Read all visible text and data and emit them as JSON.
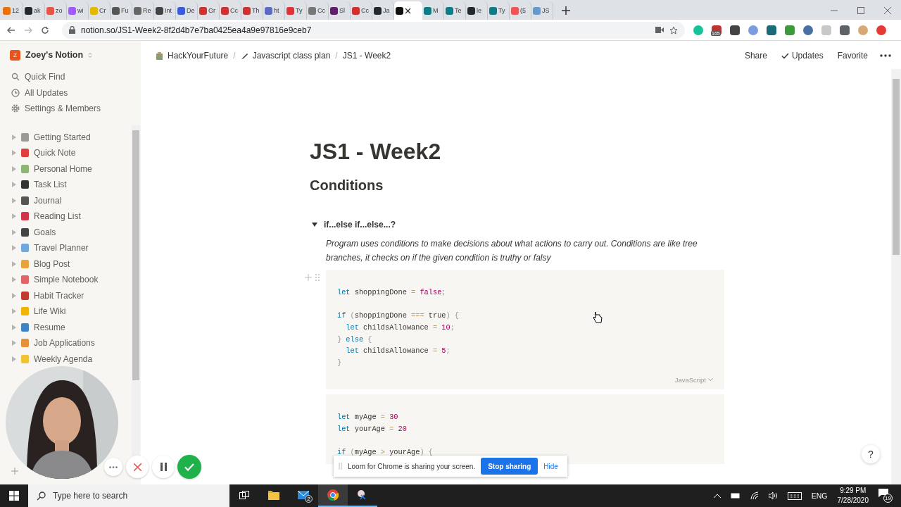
{
  "browser": {
    "tabs": [
      {
        "title": "12",
        "color": "#e8710a",
        "selected": false
      },
      {
        "title": "ak",
        "color": "#24292e",
        "selected": false
      },
      {
        "title": "zo",
        "color": "#e45649",
        "selected": false
      },
      {
        "title": "wi",
        "color": "#a259ff",
        "selected": false
      },
      {
        "title": "Cr",
        "color": "#e5b800",
        "selected": false
      },
      {
        "title": "Fu",
        "color": "#555555",
        "selected": false
      },
      {
        "title": "Re",
        "color": "#666666",
        "selected": false
      },
      {
        "title": "Int",
        "color": "#444444",
        "selected": false
      },
      {
        "title": "De",
        "color": "#3b5bdb",
        "selected": false
      },
      {
        "title": "Gr",
        "color": "#d03030",
        "selected": false
      },
      {
        "title": "Cc",
        "color": "#d03030",
        "selected": false
      },
      {
        "title": "Th",
        "color": "#d03030",
        "selected": false
      },
      {
        "title": "ht",
        "color": "#5c6bc0",
        "selected": false
      },
      {
        "title": "Ty",
        "color": "#e03333",
        "selected": false
      },
      {
        "title": "Cc",
        "color": "#777777",
        "selected": false
      },
      {
        "title": "Sl",
        "color": "#611f69",
        "selected": false
      },
      {
        "title": "Cc",
        "color": "#d03030",
        "selected": false
      },
      {
        "title": "Ja",
        "color": "#24292e",
        "selected": false
      },
      {
        "color": "#111111",
        "selected": true
      },
      {
        "title": "M",
        "color": "#0e7c86",
        "selected": false
      },
      {
        "title": "Te",
        "color": "#0e7c86",
        "selected": false
      },
      {
        "title": "le",
        "color": "#24292e",
        "selected": false
      },
      {
        "title": "Ty",
        "color": "#0e7c86",
        "selected": false
      },
      {
        "title": "(5",
        "color": "#f05555",
        "selected": false
      },
      {
        "title": "JS",
        "color": "#6699cc",
        "selected": false
      }
    ],
    "url": "notion.so/JS1-Week2-8f2d4b7e7ba0425ea4a9e97816e9ceb7",
    "extension_badge": "165"
  },
  "sidebar": {
    "workspace": "Zoey's Notion",
    "workspace_initial": "Z",
    "nav": [
      {
        "label": "Quick Find",
        "kind": "search"
      },
      {
        "label": "All Updates",
        "kind": "clock"
      },
      {
        "label": "Settings & Members",
        "kind": "gear"
      }
    ],
    "pages": [
      {
        "label": "Getting Started",
        "color": "#9b9a97",
        "expanded": false
      },
      {
        "label": "Quick Note",
        "color": "#e03e3e",
        "expanded": false
      },
      {
        "label": "Personal Home",
        "color": "#8fb573",
        "expanded": false
      },
      {
        "label": "Task List",
        "color": "#333333",
        "expanded": false
      },
      {
        "label": "Journal",
        "color": "#555555",
        "expanded": false
      },
      {
        "label": "Reading List",
        "color": "#d1334a",
        "expanded": false
      },
      {
        "label": "Goals",
        "color": "#444444",
        "expanded": false
      },
      {
        "label": "Travel Planner",
        "color": "#6fa8dc",
        "expanded": false
      },
      {
        "label": "Blog Post",
        "color": "#e8a33d",
        "expanded": false
      },
      {
        "label": "Simple Notebook",
        "color": "#e06666",
        "expanded": false
      },
      {
        "label": "Habit Tracker",
        "color": "#c0392b",
        "expanded": false
      },
      {
        "label": "Life Wiki",
        "color": "#f0b400",
        "expanded": false
      },
      {
        "label": "Resume",
        "color": "#3d85c6",
        "expanded": false
      },
      {
        "label": "Job Applications",
        "color": "#e69138",
        "expanded": false
      },
      {
        "label": "Weekly Agenda",
        "color": "#f1c232",
        "expanded": false
      }
    ]
  },
  "topbar": {
    "breadcrumbs": [
      {
        "label": "HackYourFuture"
      },
      {
        "label": "Javascript class plan",
        "separator": "/"
      },
      {
        "label": "JS1 - Week2",
        "separator": "/"
      }
    ],
    "actions": [
      {
        "label": "Share",
        "kind": "text"
      },
      {
        "label": "Updates",
        "kind": "check"
      },
      {
        "label": "Favorite",
        "kind": "text"
      }
    ]
  },
  "page": {
    "title": "JS1 - Week2",
    "heading": "Conditions",
    "toggle": {
      "label": "if...else if...else...?",
      "expanded": true,
      "text": "Program uses conditions to make decisions about what actions to carry out. Conditions are like tree branches, it checks on if the given condition is truthy or falsy"
    },
    "code_blocks": [
      {
        "language": "JavaScript",
        "lines": [
          {
            "kind": "code",
            "tokens": [
              {
                "kind": "kw",
                "t": "let"
              },
              {
                "kind": "plain",
                "t": " shoppingDone "
              },
              {
                "kind": "op",
                "t": "="
              },
              {
                "kind": "val",
                "t": " false"
              },
              {
                "kind": "punc",
                "t": ";"
              }
            ]
          },
          {
            "kind": "blank"
          },
          {
            "kind": "code",
            "tokens": [
              {
                "kind": "kw",
                "t": "if"
              },
              {
                "kind": "punc",
                "t": " ("
              },
              {
                "kind": "plain",
                "t": "shoppingDone "
              },
              {
                "kind": "op",
                "t": "==="
              },
              {
                "kind": "plain",
                "t": " true"
              },
              {
                "kind": "punc",
                "t": ") {"
              }
            ]
          },
          {
            "kind": "code",
            "tokens": [
              {
                "kind": "kw",
                "t": "  let"
              },
              {
                "kind": "plain",
                "t": " childsAllowance "
              },
              {
                "kind": "op",
                "t": "="
              },
              {
                "kind": "val",
                "t": " 10"
              },
              {
                "kind": "punc",
                "t": ";"
              }
            ]
          },
          {
            "kind": "code",
            "tokens": [
              {
                "kind": "punc",
                "t": "}"
              },
              {
                "kind": "kw",
                "t": " else"
              },
              {
                "kind": "punc",
                "t": " {"
              }
            ]
          },
          {
            "kind": "code",
            "tokens": [
              {
                "kind": "kw",
                "t": "  let"
              },
              {
                "kind": "plain",
                "t": " childsAllowance "
              },
              {
                "kind": "op",
                "t": "="
              },
              {
                "kind": "val",
                "t": " 5"
              },
              {
                "kind": "punc",
                "t": ";"
              }
            ]
          },
          {
            "kind": "code",
            "tokens": [
              {
                "kind": "punc",
                "t": "}"
              }
            ]
          }
        ]
      },
      {
        "lines": [
          {
            "kind": "code",
            "tokens": [
              {
                "kind": "kw",
                "t": "let"
              },
              {
                "kind": "plain",
                "t": " myAge "
              },
              {
                "kind": "op",
                "t": "="
              },
              {
                "kind": "val",
                "t": " 30"
              }
            ]
          },
          {
            "kind": "code",
            "tokens": [
              {
                "kind": "kw",
                "t": "let"
              },
              {
                "kind": "plain",
                "t": " yourAge "
              },
              {
                "kind": "op",
                "t": "="
              },
              {
                "kind": "val",
                "t": " 20"
              }
            ]
          },
          {
            "kind": "blank"
          },
          {
            "kind": "code",
            "tokens": [
              {
                "kind": "kw",
                "t": "if"
              },
              {
                "kind": "punc",
                "t": " ("
              },
              {
                "kind": "plain",
                "t": "myAge "
              },
              {
                "kind": "op",
                "t": ">"
              },
              {
                "kind": "plain",
                "t": " yourAge"
              },
              {
                "kind": "punc",
                "t": ") {"
              }
            ]
          }
        ]
      }
    ]
  },
  "help": "?",
  "loom": {
    "message": "Loom for Chrome is sharing your screen.",
    "stop": "Stop sharing",
    "hide": "Hide"
  },
  "taskbar": {
    "search_placeholder": "Type here to search",
    "mail_badge": "2",
    "language": "ENG",
    "time": "9:29 PM",
    "date": "7/28/2020",
    "notifications": "19"
  }
}
